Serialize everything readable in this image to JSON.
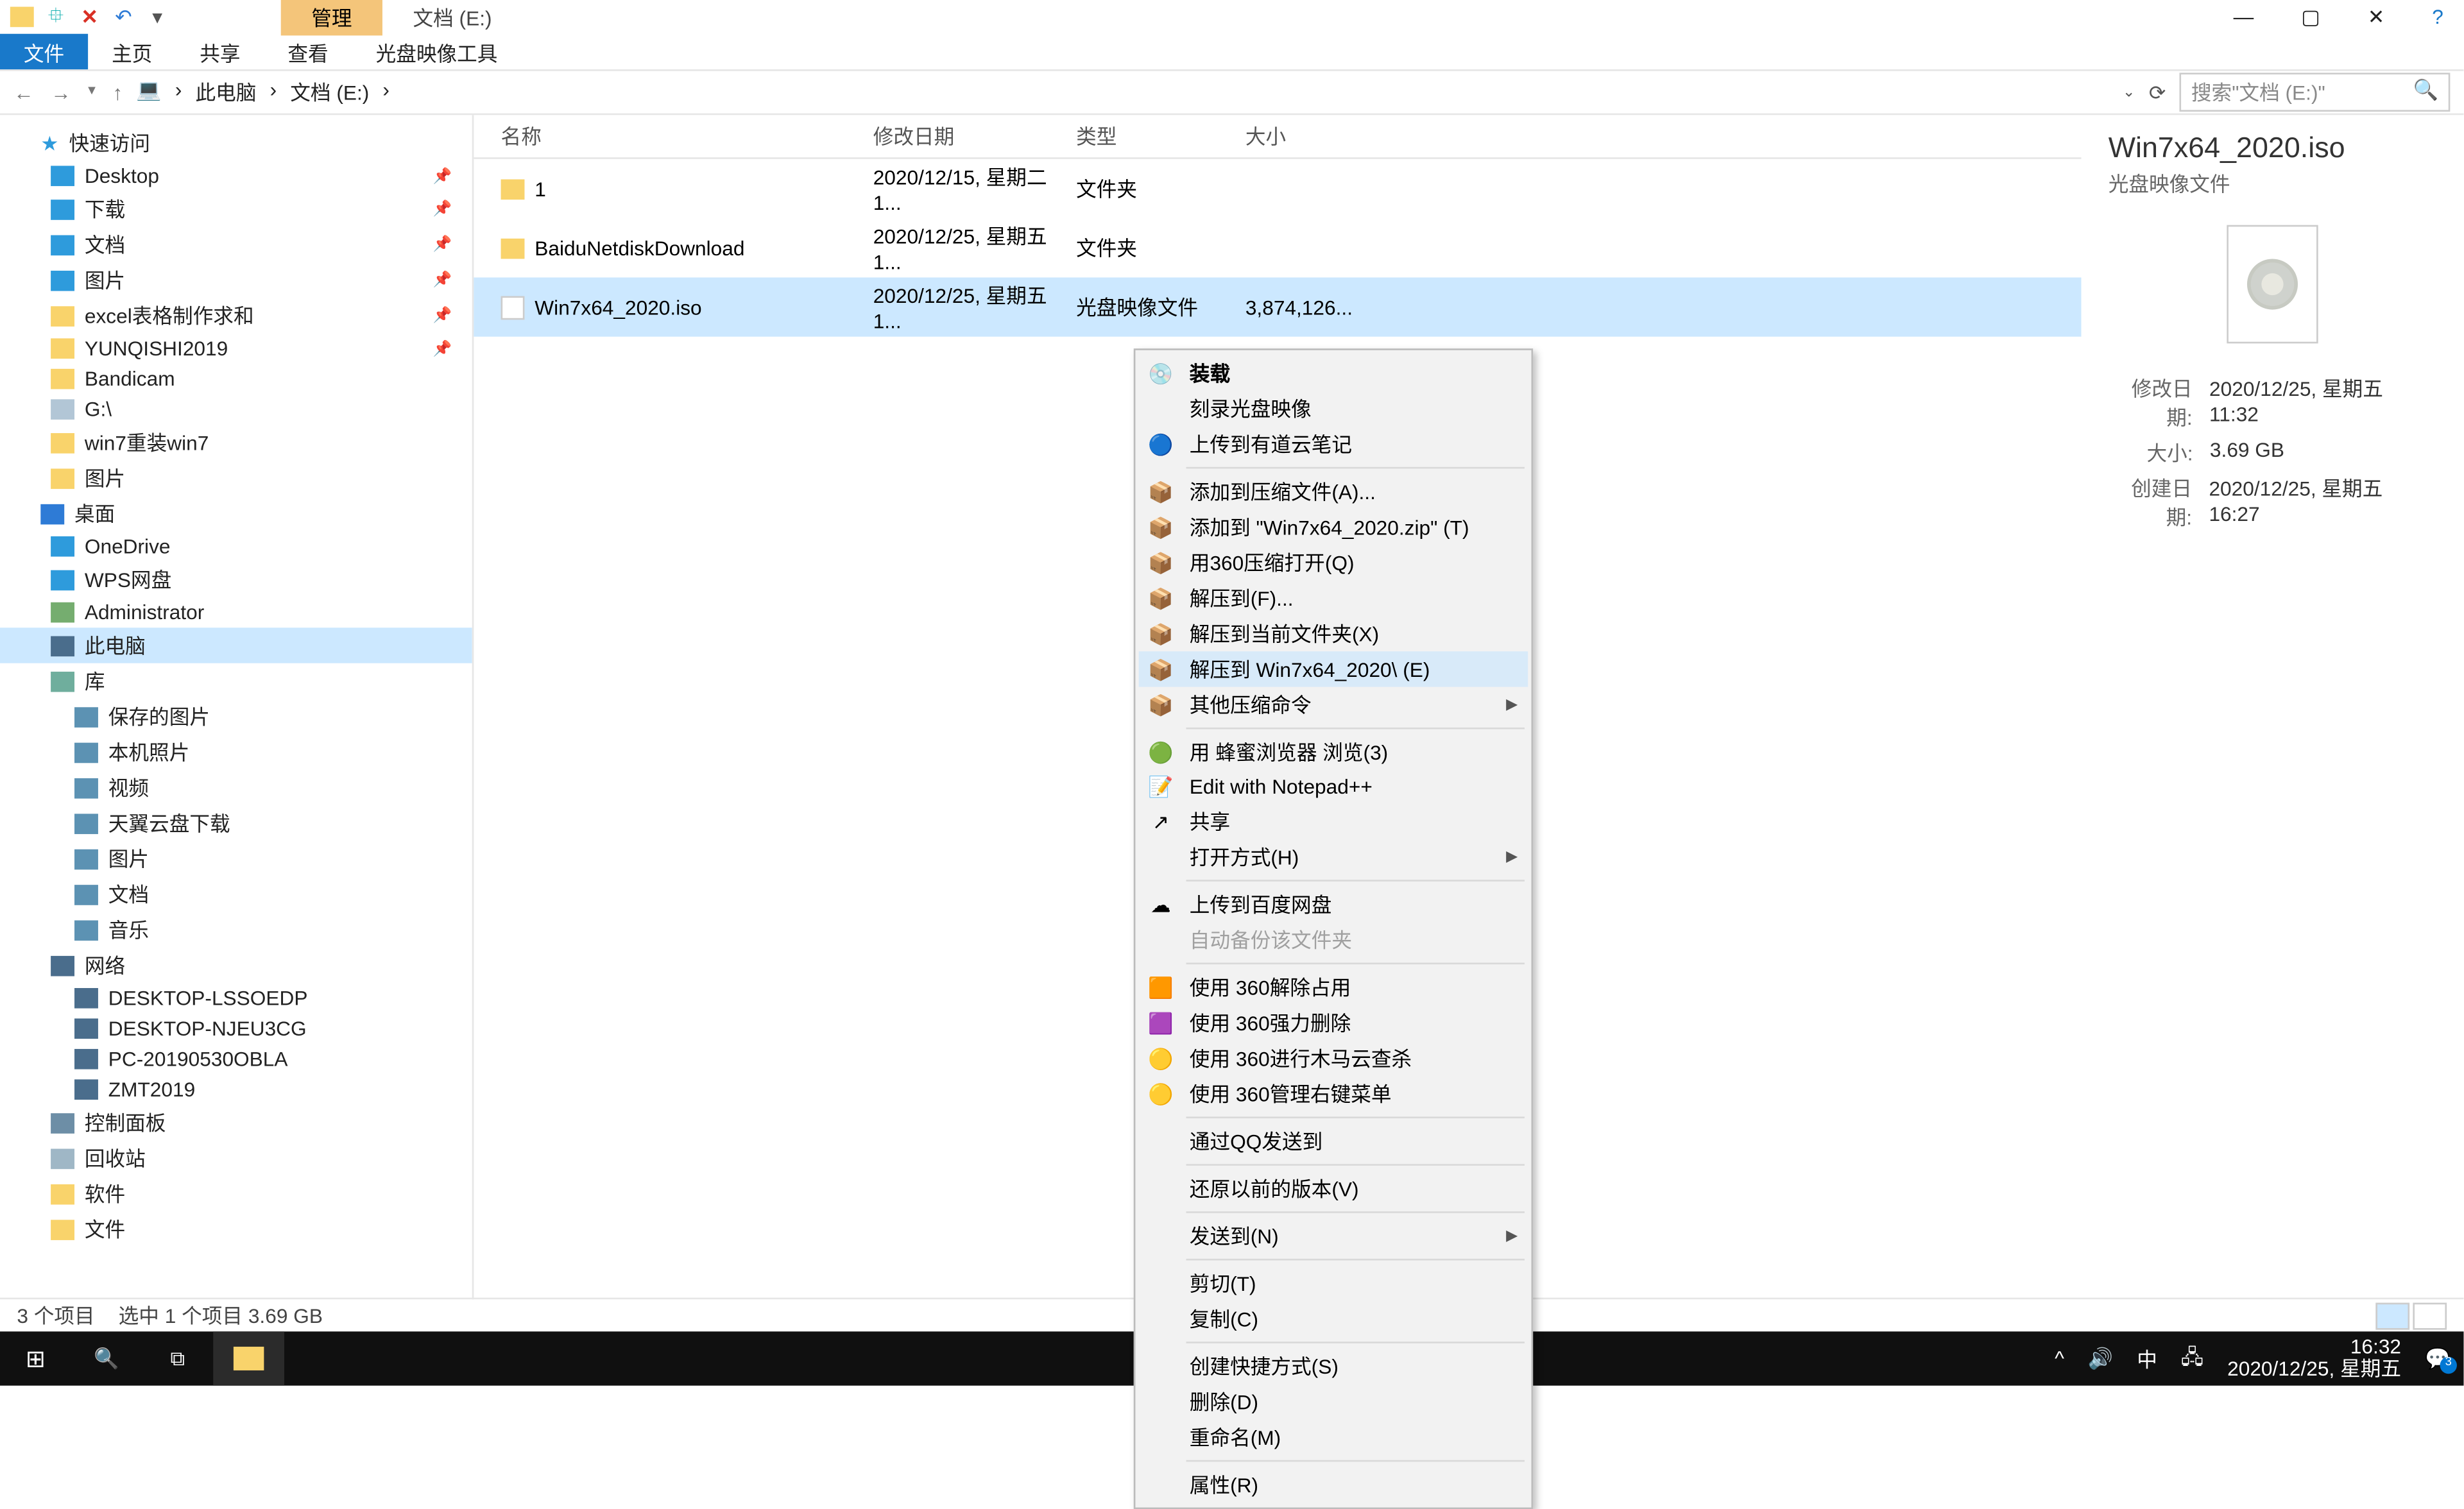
{
  "title_tabs": {
    "manage": "管理",
    "drive": "文档 (E:)"
  },
  "ribbon": {
    "file": "文件",
    "home": "主页",
    "share": "共享",
    "view": "查看",
    "iso": "光盘映像工具"
  },
  "crumb": {
    "pc": "此电脑",
    "drive": "文档 (E:)",
    "search_ph": "搜索\"文档 (E:)\""
  },
  "tree": [
    {
      "lbl": "快速访问",
      "ic": "#2e7bd6",
      "d": 0,
      "star": true
    },
    {
      "lbl": "Desktop",
      "ic": "#2e9bdc",
      "d": 1,
      "pin": true
    },
    {
      "lbl": "下载",
      "ic": "#2e9bdc",
      "d": 1,
      "pin": true
    },
    {
      "lbl": "文档",
      "ic": "#2e9bdc",
      "d": 1,
      "pin": true
    },
    {
      "lbl": "图片",
      "ic": "#2e9bdc",
      "d": 1,
      "pin": true
    },
    {
      "lbl": "excel表格制作求和",
      "ic": "#f9d36b",
      "d": 1,
      "pin": true
    },
    {
      "lbl": "YUNQISHI2019",
      "ic": "#f9d36b",
      "d": 1,
      "pin": true
    },
    {
      "lbl": "Bandicam",
      "ic": "#f9d36b",
      "d": 1
    },
    {
      "lbl": "G:\\",
      "ic": "#b2c6d6",
      "d": 1
    },
    {
      "lbl": "win7重装win7",
      "ic": "#f9d36b",
      "d": 1
    },
    {
      "lbl": "图片",
      "ic": "#f9d36b",
      "d": 1
    },
    {
      "lbl": "桌面",
      "ic": "#2e7bd6",
      "d": 0
    },
    {
      "lbl": "OneDrive",
      "ic": "#2e9bdc",
      "d": 1
    },
    {
      "lbl": "WPS网盘",
      "ic": "#2e9bdc",
      "d": 1
    },
    {
      "lbl": "Administrator",
      "ic": "#75ad6f",
      "d": 1
    },
    {
      "lbl": "此电脑",
      "ic": "#4a6d8c",
      "d": 1,
      "sel": true
    },
    {
      "lbl": "库",
      "ic": "#6fae9d",
      "d": 1
    },
    {
      "lbl": "保存的图片",
      "ic": "#5c92b3",
      "d": 2
    },
    {
      "lbl": "本机照片",
      "ic": "#5c92b3",
      "d": 2
    },
    {
      "lbl": "视频",
      "ic": "#5c92b3",
      "d": 2
    },
    {
      "lbl": "天翼云盘下载",
      "ic": "#5c92b3",
      "d": 2
    },
    {
      "lbl": "图片",
      "ic": "#5c92b3",
      "d": 2
    },
    {
      "lbl": "文档",
      "ic": "#5c92b3",
      "d": 2
    },
    {
      "lbl": "音乐",
      "ic": "#5c92b3",
      "d": 2
    },
    {
      "lbl": "网络",
      "ic": "#4a6d8c",
      "d": 1
    },
    {
      "lbl": "DESKTOP-LSSOEDP",
      "ic": "#4a6d8c",
      "d": 2
    },
    {
      "lbl": "DESKTOP-NJEU3CG",
      "ic": "#4a6d8c",
      "d": 2
    },
    {
      "lbl": "PC-20190530OBLA",
      "ic": "#4a6d8c",
      "d": 2
    },
    {
      "lbl": "ZMT2019",
      "ic": "#4a6d8c",
      "d": 2
    },
    {
      "lbl": "控制面板",
      "ic": "#6d8ea6",
      "d": 1
    },
    {
      "lbl": "回收站",
      "ic": "#9fb7c6",
      "d": 1
    },
    {
      "lbl": "软件",
      "ic": "#f9d36b",
      "d": 1
    },
    {
      "lbl": "文件",
      "ic": "#f9d36b",
      "d": 1
    }
  ],
  "cols": {
    "name": "名称",
    "date": "修改日期",
    "type": "类型",
    "size": "大小"
  },
  "rows": [
    {
      "name": "1",
      "date": "2020/12/15, 星期二 1...",
      "type": "文件夹",
      "size": "",
      "folder": true
    },
    {
      "name": "BaiduNetdiskDownload",
      "date": "2020/12/25, 星期五 1...",
      "type": "文件夹",
      "size": "",
      "folder": true
    },
    {
      "name": "Win7x64_2020.iso",
      "date": "2020/12/25, 星期五 1...",
      "type": "光盘映像文件",
      "size": "3,874,126...",
      "folder": false,
      "sel": true
    }
  ],
  "ctx": [
    {
      "t": "装载",
      "bold": true,
      "ic": "disc"
    },
    {
      "t": "刻录光盘映像"
    },
    {
      "t": "上传到有道云笔记",
      "ic": "blue"
    },
    {
      "sep": true
    },
    {
      "t": "添加到压缩文件(A)...",
      "ic": "zip"
    },
    {
      "t": "添加到 \"Win7x64_2020.zip\" (T)",
      "ic": "zip"
    },
    {
      "t": "用360压缩打开(Q)",
      "ic": "zip"
    },
    {
      "t": "解压到(F)...",
      "ic": "zip"
    },
    {
      "t": "解压到当前文件夹(X)",
      "ic": "zip"
    },
    {
      "t": "解压到 Win7x64_2020\\ (E)",
      "ic": "zip",
      "hover": true
    },
    {
      "t": "其他压缩命令",
      "ic": "zip",
      "sub": true
    },
    {
      "sep": true
    },
    {
      "t": "用 蜂蜜浏览器 浏览(3)",
      "ic": "green"
    },
    {
      "t": "Edit with Notepad++",
      "ic": "npp"
    },
    {
      "t": "共享",
      "ic": "share"
    },
    {
      "t": "打开方式(H)",
      "sub": true
    },
    {
      "sep": true
    },
    {
      "t": "上传到百度网盘",
      "ic": "cloud"
    },
    {
      "t": "自动备份该文件夹",
      "disabled": true
    },
    {
      "sep": true
    },
    {
      "t": "使用 360解除占用",
      "ic": "360o"
    },
    {
      "t": "使用 360强力删除",
      "ic": "360d"
    },
    {
      "t": "使用 360进行木马云查杀",
      "ic": "360y"
    },
    {
      "t": "使用 360管理右键菜单",
      "ic": "360y"
    },
    {
      "sep": true
    },
    {
      "t": "通过QQ发送到"
    },
    {
      "sep": true
    },
    {
      "t": "还原以前的版本(V)"
    },
    {
      "sep": true
    },
    {
      "t": "发送到(N)",
      "sub": true
    },
    {
      "sep": true
    },
    {
      "t": "剪切(T)"
    },
    {
      "t": "复制(C)"
    },
    {
      "sep": true
    },
    {
      "t": "创建快捷方式(S)"
    },
    {
      "t": "删除(D)"
    },
    {
      "t": "重命名(M)"
    },
    {
      "sep": true
    },
    {
      "t": "属性(R)"
    }
  ],
  "preview": {
    "title": "Win7x64_2020.iso",
    "sub": "光盘映像文件",
    "meta": [
      {
        "k": "修改日期:",
        "v": "2020/12/25, 星期五 11:32"
      },
      {
        "k": "大小:",
        "v": "3.69 GB"
      },
      {
        "k": "创建日期:",
        "v": "2020/12/25, 星期五 16:27"
      }
    ]
  },
  "status": {
    "count": "3 个项目",
    "sel": "选中 1 个项目  3.69 GB"
  },
  "tray": {
    "time": "16:32",
    "date": "2020/12/25, 星期五",
    "ime": "中"
  }
}
